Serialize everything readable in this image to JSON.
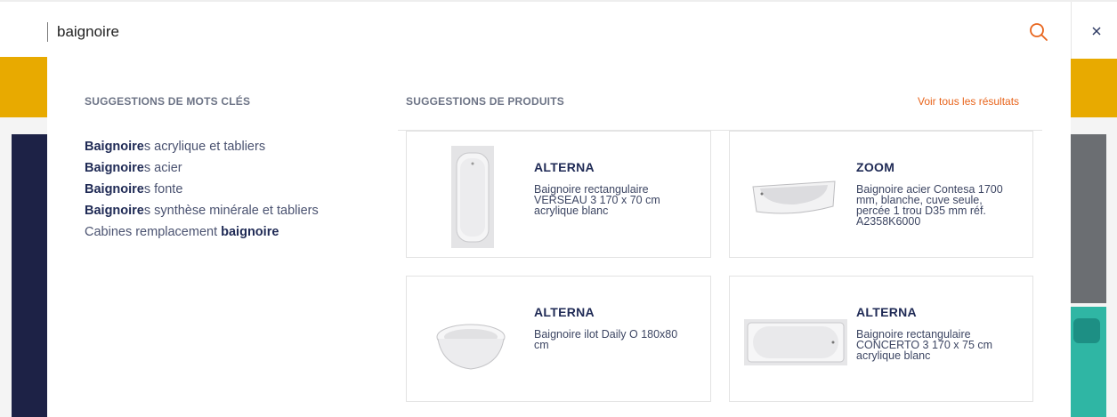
{
  "search": {
    "value": "baignoire",
    "placeholder": ""
  },
  "icons": {
    "search": "search-icon",
    "close": "close-icon"
  },
  "colors": {
    "accent": "#e8641b",
    "brand_yellow": "#e8aa00",
    "text_dark": "#1f2a55"
  },
  "keywords": {
    "title": "SUGGESTIONS DE MOTS CLÉS",
    "items": [
      {
        "match": "Baignoire",
        "rest": "s acrylique et tabliers",
        "prefix": ""
      },
      {
        "match": "Baignoire",
        "rest": "s acier",
        "prefix": ""
      },
      {
        "match": "Baignoire",
        "rest": "s fonte",
        "prefix": ""
      },
      {
        "match": "Baignoire",
        "rest": "s synthèse minérale et tabliers",
        "prefix": ""
      },
      {
        "match": "baignoire",
        "rest": "",
        "prefix": "Cabines remplacement "
      }
    ]
  },
  "products": {
    "title": "SUGGESTIONS DE PRODUITS",
    "see_all": "Voir tous les résultats",
    "items": [
      {
        "brand": "ALTERNA",
        "desc": "Baignoire rectangulaire VERSEAU 3 170 x 70 cm acrylique blanc",
        "image": "bathtub-top-view"
      },
      {
        "brand": "ZOOM",
        "desc": "Baignoire acier Contesa 1700 mm, blanche, cuve seule, percée 1 trou D35 mm réf. A2358K6000",
        "image": "bathtub-angled"
      },
      {
        "brand": "ALTERNA",
        "desc": "Baignoire ilot Daily O 180x80 cm",
        "image": "freestanding-bathtub"
      },
      {
        "brand": "ALTERNA",
        "desc": "Baignoire rectangulaire CONCERTO 3 170 x 75 cm acrylique blanc",
        "image": "bathtub-top-view-wide"
      }
    ]
  }
}
